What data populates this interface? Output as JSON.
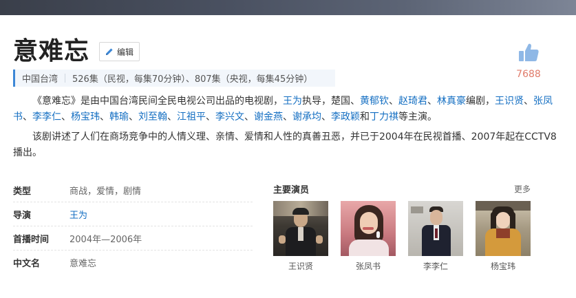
{
  "header": {
    "title": "意难忘",
    "edit_label": "编辑"
  },
  "summary": {
    "region": "中国台湾",
    "episodes": "526集（民视，每集70分钟）、807集（央视，每集45分钟）"
  },
  "like": {
    "count": "7688"
  },
  "intro": {
    "p1": [
      {
        "t": "《意难忘》是由中国台湾民间全民电视公司出品的电视剧，",
        "link": false
      },
      {
        "t": "王为",
        "link": true
      },
      {
        "t": "执导，楚国、",
        "link": false
      },
      {
        "t": "黄郁钦",
        "link": true
      },
      {
        "t": "、",
        "link": false
      },
      {
        "t": "赵琦君",
        "link": true
      },
      {
        "t": "、",
        "link": false
      },
      {
        "t": "林真豪",
        "link": true
      },
      {
        "t": "编剧，",
        "link": false
      },
      {
        "t": "王识贤",
        "link": true
      },
      {
        "t": "、",
        "link": false
      },
      {
        "t": "张凤书",
        "link": true
      },
      {
        "t": "、",
        "link": false
      },
      {
        "t": "李李仁",
        "link": true
      },
      {
        "t": "、",
        "link": false
      },
      {
        "t": "杨宝玮",
        "link": true
      },
      {
        "t": "、",
        "link": false
      },
      {
        "t": "韩瑜",
        "link": true
      },
      {
        "t": "、",
        "link": false
      },
      {
        "t": "刘至翰",
        "link": true
      },
      {
        "t": "、",
        "link": false
      },
      {
        "t": "江祖平",
        "link": true
      },
      {
        "t": "、",
        "link": false
      },
      {
        "t": "李兴文",
        "link": true
      },
      {
        "t": "、",
        "link": false
      },
      {
        "t": "谢金燕",
        "link": true
      },
      {
        "t": "、",
        "link": false
      },
      {
        "t": "谢承均",
        "link": true
      },
      {
        "t": "、",
        "link": false
      },
      {
        "t": "李政颖",
        "link": true
      },
      {
        "t": "和",
        "link": false
      },
      {
        "t": "丁力祺",
        "link": true
      },
      {
        "t": "等主演。",
        "link": false
      }
    ],
    "p2": "该剧讲述了人们在商场竞争中的人情义理、亲情、爱情和人性的真善丑恶，并已于2004年在民视首播、2007年起在CCTV8播出。"
  },
  "info": [
    {
      "key": "类型",
      "value": "商战，爱情，剧情",
      "link": false
    },
    {
      "key": "导演",
      "value": "王为",
      "link": true
    },
    {
      "key": "首播时间",
      "value": "2004年—2006年",
      "link": false
    },
    {
      "key": "中文名",
      "value": "意难忘",
      "link": false
    }
  ],
  "cast": {
    "title": "主要演员",
    "more_label": "更多",
    "members": [
      {
        "name": "王识贤"
      },
      {
        "name": "张凤书"
      },
      {
        "name": "李李仁"
      },
      {
        "name": "杨宝玮"
      }
    ]
  },
  "colors": {
    "link": "#136ec2",
    "accent_bar": "#3c87d6",
    "like_icon": "#8fb8e6",
    "like_count": "#e07b6a"
  }
}
